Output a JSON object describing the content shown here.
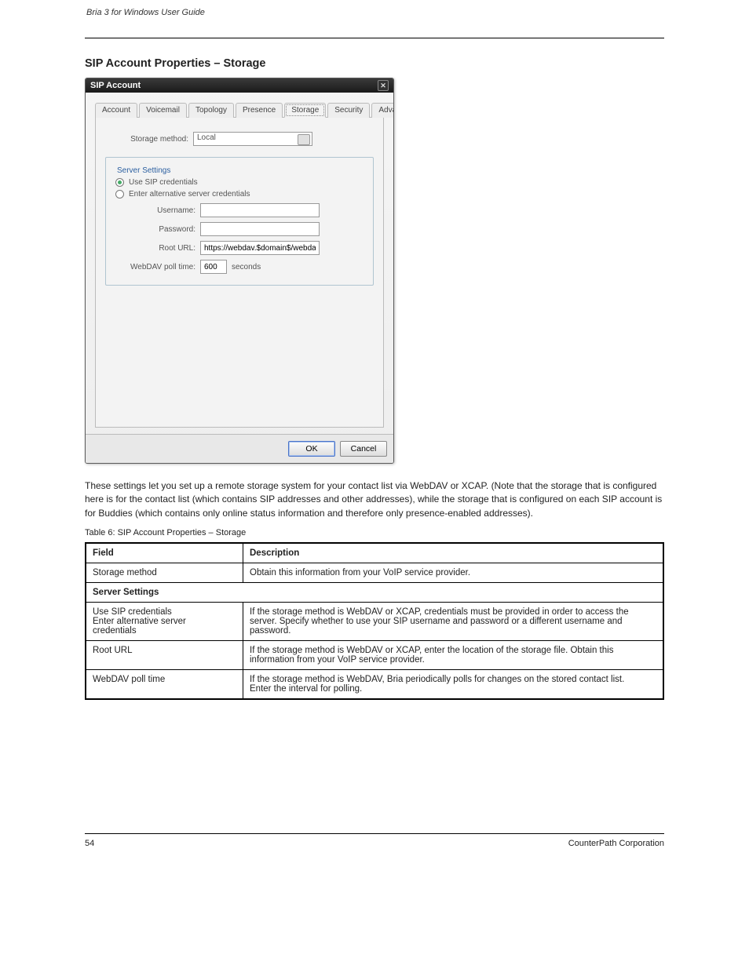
{
  "header": {
    "left": "Bria 3 for Windows  User Guide",
    "right": ""
  },
  "section": {
    "title": "SIP Account Properties – Storage",
    "intro": "These settings let you set up a remote storage system for your contact list via WebDAV or XCAP. (Note that the storage that is configured here is for the contact list (which contains SIP addresses and other addresses), while the storage that is configured on each SIP account is for Buddies (which contains only online status information and therefore only presence-enabled addresses)."
  },
  "dialog": {
    "title": "SIP Account",
    "close_x": "✕",
    "tabs": [
      "Account",
      "Voicemail",
      "Topology",
      "Presence",
      "Storage",
      "Security",
      "Advanced"
    ],
    "storage_method_label": "Storage method:",
    "storage_method_value": "Local",
    "server_settings_legend": "Server Settings",
    "radio_sip": "Use SIP credentials",
    "radio_alt": "Enter alternative server credentials",
    "username_label": "Username:",
    "username_value": "",
    "password_label": "Password:",
    "password_value": "",
    "root_url_label": "Root URL:",
    "root_url_value": "https://webdav.$domain$/webdav/$use",
    "poll_label": "WebDAV poll time:",
    "poll_value": "600",
    "poll_units": "seconds",
    "ok": "OK",
    "cancel": "Cancel"
  },
  "table": {
    "caption": "Table 6: SIP Account Properties – Storage",
    "headers": [
      "Field",
      "Description"
    ],
    "row_storage_method": {
      "field": "Storage method",
      "desc": "Obtain this information from your VoIP service provider."
    },
    "section_title": "Server Settings",
    "row_credentials": {
      "field": "Use SIP credentials\nEnter alternative server\ncredentials",
      "desc": "If the storage method is WebDAV or XCAP, credentials must be provided in order to access the\nserver. Specify whether to use your SIP username and password or a different username and\npassword."
    },
    "row_root_url": {
      "field": "Root URL",
      "desc": "If the storage method is WebDAV or XCAP, enter the location of the storage file. Obtain this\ninformation from your VoIP service provider."
    },
    "row_poll": {
      "field": "WebDAV poll time",
      "desc": "If the storage method is WebDAV, Bria periodically polls for changes on the stored contact list.\nEnter the interval for polling."
    }
  },
  "footer": {
    "left": "54",
    "right": "CounterPath Corporation"
  }
}
